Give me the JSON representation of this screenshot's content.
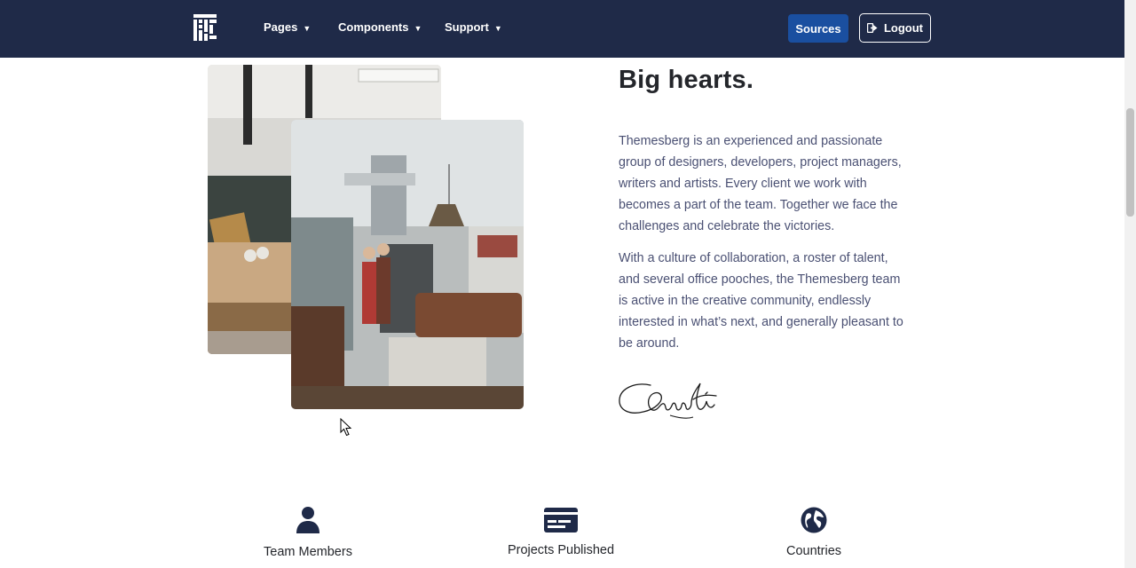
{
  "navbar": {
    "items": [
      {
        "label": "Pages"
      },
      {
        "label": "Components"
      },
      {
        "label": "Support"
      }
    ],
    "sources_label": "Sources",
    "logout_label": "Logout"
  },
  "about": {
    "title": "Big hearts.",
    "paragraph_1": "Themesberg is an experienced and passionate group of designers, developers, project managers, writers and artists. Every client we work with becomes a part of the team. Together we face the challenges and celebrate the victories.",
    "paragraph_2": "With a culture of collaboration, a roster of talent, and several office pooches, the Themesberg team is active in the creative community, endlessly interested in what’s next, and generally pleasant to be around."
  },
  "stats": [
    {
      "label": "Team Members",
      "icon": "user-icon"
    },
    {
      "label": "Projects Published",
      "icon": "credit-card-icon"
    },
    {
      "label": "Countries",
      "icon": "globe-icon"
    }
  ],
  "colors": {
    "navbar_bg": "#1f2a48",
    "primary_button": "#1a4fa0",
    "icon_color": "#1f2a48",
    "body_text": "#4a5073"
  }
}
